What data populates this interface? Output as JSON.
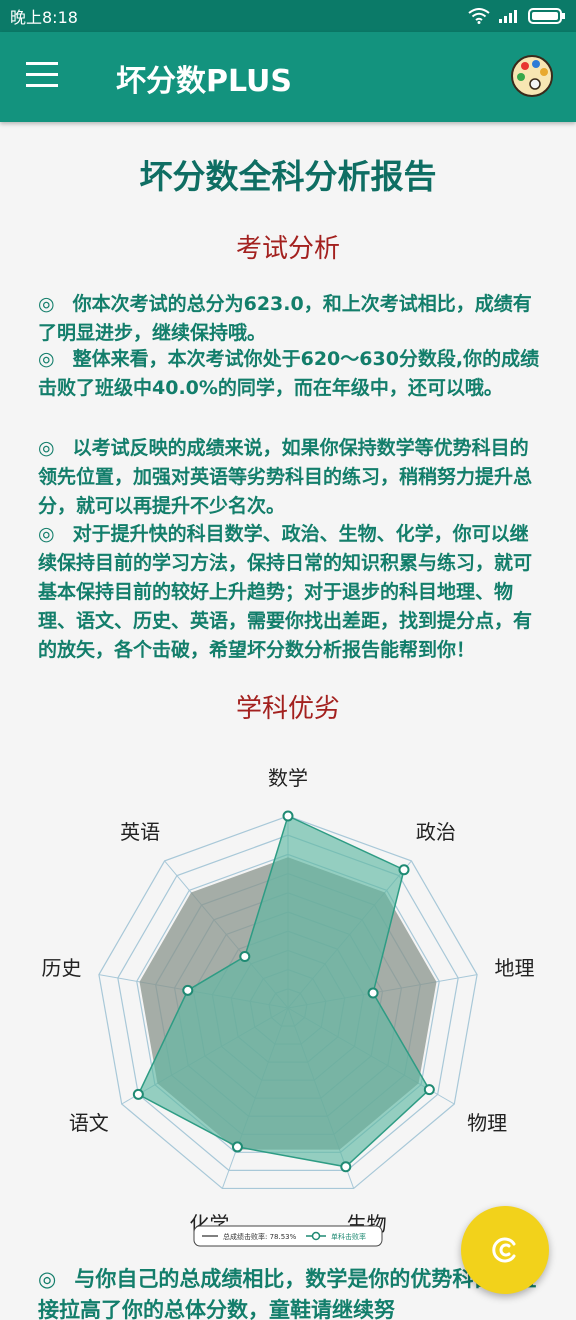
{
  "status_bar": {
    "time": "晚上8:18"
  },
  "app_bar": {
    "title": "坏分数PLUS",
    "menu_icon": "hamburger-menu-icon",
    "action_icon": "palette-icon"
  },
  "report": {
    "title": "坏分数全科分析报告",
    "exam_section_title": "考试分析",
    "paragraphs": [
      {
        "bullet": "◎",
        "text": "你本次考试的总分为623.0，和上次考试相比，成绩有了明显进步，继续保持哦。"
      },
      {
        "bullet": "◎",
        "text": "整体来看，本次考试你处于620～630分数段,你的成绩击败了班级中40.0%的同学，而在年级中，还可以哦。"
      },
      {
        "bullet": "◎",
        "text": "以考试反映的成绩来说，如果你保持数学等优势科目的领先位置，加强对英语等劣势科目的练习，稍稍努力提升总分，就可以再提升不少名次。"
      },
      {
        "bullet": "◎",
        "text": "对于提升快的科目数学、政治、生物、化学，你可以继续保持目前的学习方法，保持日常的知识积累与练习，就可基本保持目前的较好上升趋势；对于退步的科目地理、物理、语文、历史、英语，需要你找出差距，找到提分点，有的放矢，各个击破，希望坏分数分析报告能帮到你！"
      }
    ],
    "subject_section_title": "学科优劣",
    "bottom_paragraph": {
      "bullet": "◎",
      "text": "与你自己的总成绩相比，数学是你的优势科目，直接拉高了你的总体分数，童鞋请继续努"
    }
  },
  "chart_data": {
    "type": "radar",
    "categories": [
      "数学",
      "政治",
      "地理",
      "物理",
      "生物",
      "化学",
      "语文",
      "历史",
      "英语"
    ],
    "series": [
      {
        "name": "总成绩击败率: 78.53%",
        "values": [
          78.53,
          78.53,
          78.53,
          78.53,
          78.53,
          78.53,
          78.53,
          78.53,
          78.53
        ],
        "color": "#8a948c"
      },
      {
        "name": "单科击败率",
        "values": [
          100,
          94,
          45,
          85,
          88,
          77,
          90,
          53,
          35
        ],
        "color": "#5fb9a3"
      }
    ],
    "range": [
      0,
      100
    ],
    "levels": 10,
    "legend_position": "bottom"
  },
  "colors": {
    "primary": "#13937e",
    "primary_dark": "#0b7a68",
    "accent": "#f2d21b",
    "section_red": "#a3211f"
  },
  "fab": {
    "icon": "refresh-c-icon"
  }
}
